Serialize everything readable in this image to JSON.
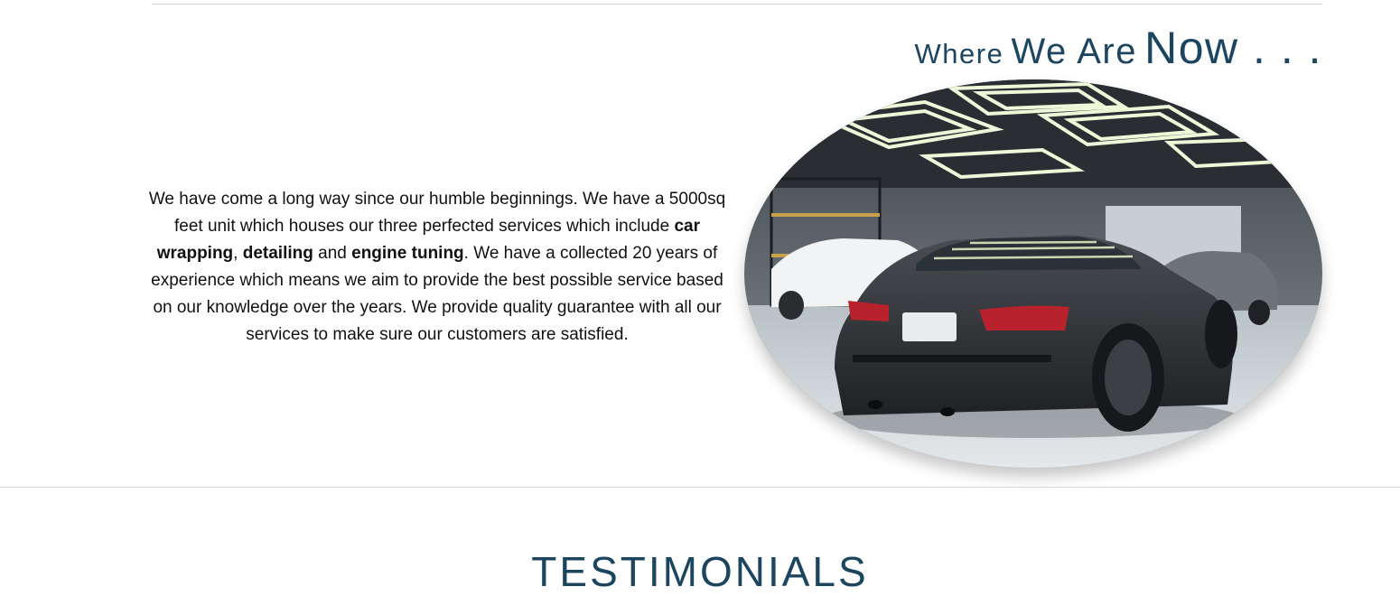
{
  "about": {
    "heading": {
      "word1": "Where",
      "word2": "We Are",
      "word3": "Now . . ."
    },
    "paragraph": {
      "part1": "We have come a long way since our humble beginnings. We have a 5000sq feet unit which houses our three perfected services which include ",
      "service1": "car wrapping",
      "sep1": ", ",
      "service2": "detailing",
      "sep2": " and ",
      "service3": "engine tuning",
      "part2": ". We have a collected 20 years of experience which means we aim to provide the best possible service based on our knowledge over the years. We provide quality guarantee with all our services to make sure our customers are satisfied."
    }
  },
  "testimonials": {
    "title": "TESTIMONIALS"
  },
  "colors": {
    "heading": "#1c4560",
    "body_text": "#111111",
    "divider": "#d8d8d8"
  }
}
